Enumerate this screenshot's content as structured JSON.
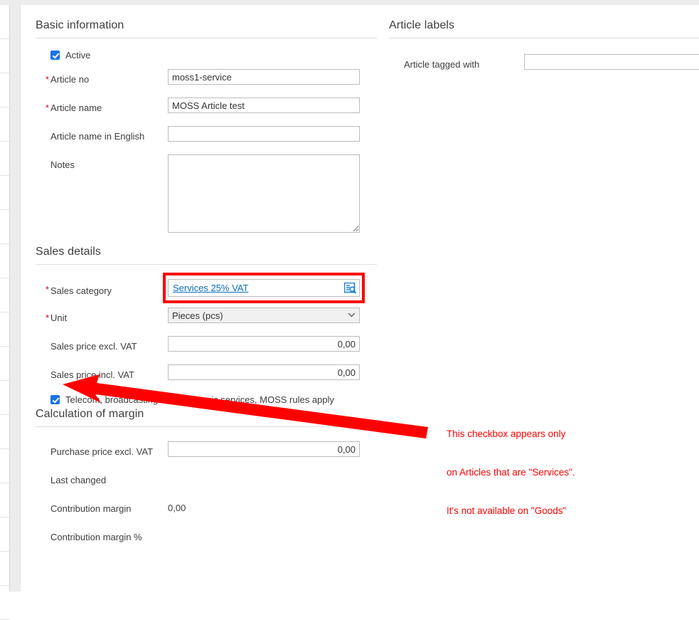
{
  "colors": {
    "accent_link": "#0a6ebd",
    "required_asterisk": "#d0021b",
    "checkbox_blue": "#1a73e8",
    "annotation_red": "#ff0000",
    "panel_bg": "#ffffff",
    "chrome_gray": "#ececec"
  },
  "basic_information": {
    "title": "Basic information",
    "active_checkbox": {
      "label": "Active",
      "checked": true
    },
    "fields": [
      {
        "label": "Article no",
        "required": true,
        "value": "moss1-service",
        "placeholder": ""
      },
      {
        "label": "Article name",
        "required": true,
        "value": "MOSS Article test",
        "placeholder": ""
      },
      {
        "label": "Article name in English",
        "required": false,
        "value": "",
        "placeholder": ""
      },
      {
        "label": "Notes",
        "required": false,
        "value": "",
        "placeholder": ""
      }
    ]
  },
  "article_labels": {
    "title": "Article labels",
    "tagged_with": {
      "label": "Article tagged with",
      "value": "",
      "placeholder": ""
    }
  },
  "sales_details": {
    "title": "Sales details",
    "sales_category": {
      "label": "Sales category",
      "required": true,
      "value": "Services 25% VAT",
      "lookup_icon": "document-search-icon",
      "highlighted": true
    },
    "unit": {
      "label": "Unit",
      "required": true,
      "value": "Pieces (pcs)",
      "chevron": "⌄"
    },
    "sales_price_excl_vat": {
      "label": "Sales price excl. VAT",
      "required": false,
      "value": "0,00"
    },
    "sales_price_incl_vat": {
      "label": "Sales price incl. VAT",
      "required": false,
      "value": "0,00"
    },
    "moss_checkbox": {
      "label": "Telecom, broadcasting and electronic services, MOSS rules apply",
      "checked": true
    }
  },
  "calculation_of_margin": {
    "title": "Calculation of margin",
    "purchase_price_excl_vat": {
      "label": "Purchase price excl. VAT",
      "value": "0,00"
    },
    "last_changed": {
      "label": "Last changed",
      "value": ""
    },
    "contribution_margin": {
      "label": "Contribution margin",
      "value": "0,00"
    },
    "contribution_margin_pct": {
      "label": "Contribution margin %",
      "value": ""
    }
  },
  "annotation": {
    "note_line1": "This checkbox appears only",
    "note_line2": "on Articles that are \"Services\".",
    "note_line3": "It's not available on \"Goods\"",
    "arrow": "arrow-pointing-left"
  }
}
